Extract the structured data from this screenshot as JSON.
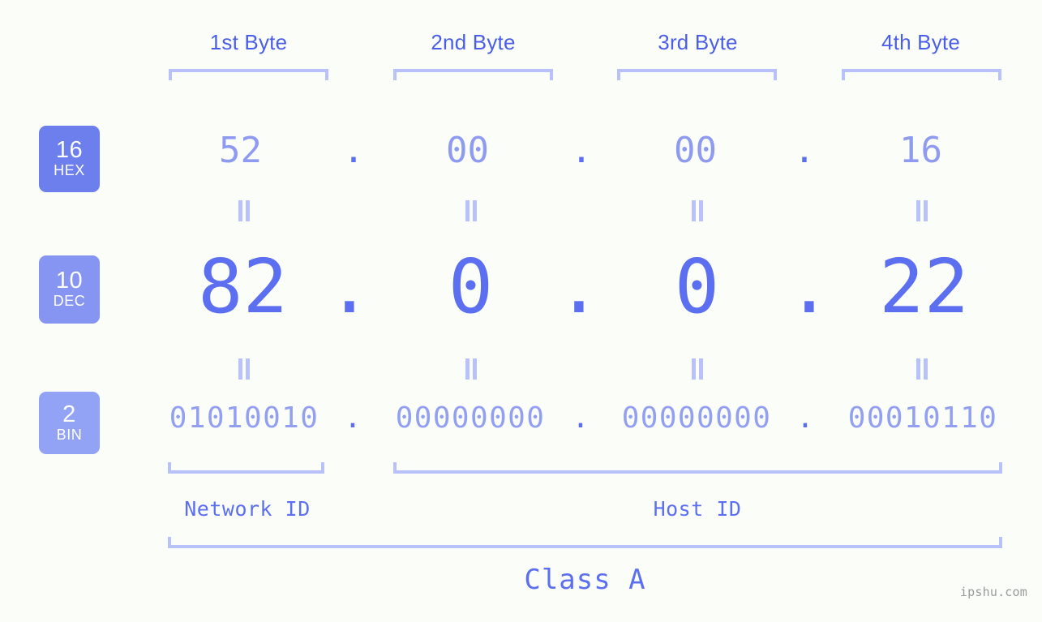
{
  "meta": {
    "background": "#fbfdf8",
    "accent": "#5b6ff0",
    "accent_light": "#b8c1fa",
    "header_color": "#4a5ee8"
  },
  "byte_headers": [
    {
      "label": "1st Byte"
    },
    {
      "label": "2nd Byte"
    },
    {
      "label": "3rd Byte"
    },
    {
      "label": "4th Byte"
    }
  ],
  "bases": [
    {
      "number": "16",
      "name": "HEX",
      "color": "#6d7fec"
    },
    {
      "number": "10",
      "name": "DEC",
      "color": "#8795f2"
    },
    {
      "number": "2",
      "name": "BIN",
      "color": "#92a3f6"
    }
  ],
  "rows": {
    "hex": {
      "base_number": "16",
      "base_name": "HEX",
      "octets": [
        "52",
        "00",
        "00",
        "16"
      ],
      "separator": "."
    },
    "dec": {
      "base_number": "10",
      "base_name": "DEC",
      "octets": [
        "82",
        "0",
        "0",
        "22"
      ],
      "separator": "."
    },
    "bin": {
      "base_number": "2",
      "base_name": "BIN",
      "octets": [
        "01010010",
        "00000000",
        "00000000",
        "00010110"
      ],
      "separator": "."
    }
  },
  "equals_marker": "=",
  "segments": {
    "network_id": "Network ID",
    "host_id": "Host ID",
    "class": "Class A"
  },
  "watermark": "ipshu.com"
}
